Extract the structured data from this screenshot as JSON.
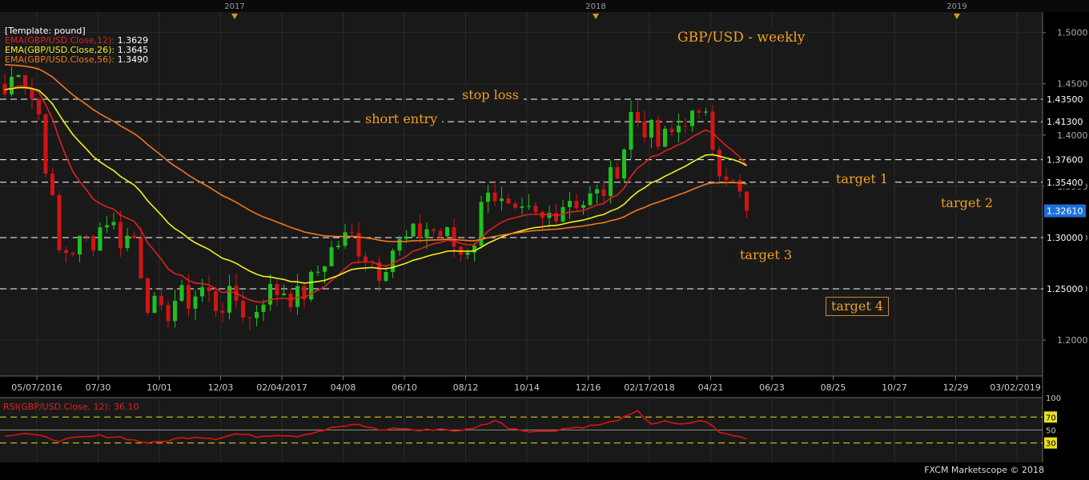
{
  "chart_data": [
    {
      "type": "candlestick",
      "title": "GBP/USD - weekly",
      "template_label": "[Template: pound]",
      "indicators": [
        {
          "label": "EMA(GBP/USD.Close,12):",
          "value": "1.3629",
          "color": "#e02020"
        },
        {
          "label": "EMA(GBP/USD.Close,26):",
          "value": "1.3645",
          "color": "#f0f020"
        },
        {
          "label": "EMA(GBP/USD.Close,56):",
          "value": "1.3490",
          "color": "#f07820"
        }
      ],
      "year_markers": [
        "2017",
        "2018",
        "2019"
      ],
      "x_tick_labels": [
        "05/07/2016",
        "07/30",
        "10/01",
        "12/03",
        "02/04/2017",
        "04/08",
        "06/10",
        "08/12",
        "10/14",
        "12/16",
        "02/17/2018",
        "04/21",
        "06/23",
        "08/25",
        "10/27",
        "12/29",
        "03/02/2019"
      ],
      "y_tick_labels": [
        "1.5000",
        "1.4500",
        "1.4000",
        "1.3500",
        "1.3000",
        "1.2500",
        "1.2000"
      ],
      "ylim": [
        1.165,
        1.52
      ],
      "price_levels": [
        {
          "value": 1.435,
          "label": "1.43500"
        },
        {
          "value": 1.413,
          "label": "1.41300"
        },
        {
          "value": 1.376,
          "label": "1.37600"
        },
        {
          "value": 1.354,
          "label": "1.35400"
        },
        {
          "value": 1.3,
          "label": "1.30000"
        },
        {
          "value": 1.25,
          "label": "1.25000"
        }
      ],
      "current_price": {
        "value": 1.3261,
        "label": "1.32610"
      },
      "annotations": [
        "GBP/USD - weekly",
        "stop loss",
        "short entry",
        "target 1",
        "target 2",
        "target 3",
        "target 4"
      ],
      "anchors": [
        {
          "week": 0,
          "price": 1.44
        },
        {
          "week": 2,
          "price": 1.47
        },
        {
          "week": 5,
          "price": 1.42
        },
        {
          "week": 7,
          "price": 1.33
        },
        {
          "week": 8,
          "price": 1.285
        },
        {
          "week": 10,
          "price": 1.29
        },
        {
          "week": 13,
          "price": 1.3
        },
        {
          "week": 15,
          "price": 1.32
        },
        {
          "week": 17,
          "price": 1.3
        },
        {
          "week": 19,
          "price": 1.3
        },
        {
          "week": 21,
          "price": 1.24
        },
        {
          "week": 23,
          "price": 1.22
        },
        {
          "week": 25,
          "price": 1.24
        },
        {
          "week": 27,
          "price": 1.24
        },
        {
          "week": 29,
          "price": 1.25
        },
        {
          "week": 31,
          "price": 1.235
        },
        {
          "week": 34,
          "price": 1.24
        },
        {
          "week": 36,
          "price": 1.22
        },
        {
          "week": 38,
          "price": 1.245
        },
        {
          "week": 41,
          "price": 1.25
        },
        {
          "week": 43,
          "price": 1.24
        },
        {
          "week": 45,
          "price": 1.255
        },
        {
          "week": 47,
          "price": 1.28
        },
        {
          "week": 49,
          "price": 1.295
        },
        {
          "week": 51,
          "price": 1.3
        },
        {
          "week": 53,
          "price": 1.285
        },
        {
          "week": 55,
          "price": 1.27
        },
        {
          "week": 57,
          "price": 1.29
        },
        {
          "week": 60,
          "price": 1.3
        },
        {
          "week": 62,
          "price": 1.31
        },
        {
          "week": 65,
          "price": 1.3
        },
        {
          "week": 67,
          "price": 1.285
        },
        {
          "week": 69,
          "price": 1.3
        },
        {
          "week": 71,
          "price": 1.355
        },
        {
          "week": 73,
          "price": 1.33
        },
        {
          "week": 75,
          "price": 1.315
        },
        {
          "week": 77,
          "price": 1.32
        },
        {
          "week": 79,
          "price": 1.315
        },
        {
          "week": 81,
          "price": 1.33
        },
        {
          "week": 83,
          "price": 1.34
        },
        {
          "week": 85,
          "price": 1.335
        },
        {
          "week": 87,
          "price": 1.34
        },
        {
          "week": 89,
          "price": 1.355
        },
        {
          "week": 91,
          "price": 1.39
        },
        {
          "week": 92,
          "price": 1.42
        },
        {
          "week": 94,
          "price": 1.41
        },
        {
          "week": 96,
          "price": 1.39
        },
        {
          "week": 98,
          "price": 1.4
        },
        {
          "week": 100,
          "price": 1.42
        },
        {
          "week": 102,
          "price": 1.41
        },
        {
          "week": 103,
          "price": 1.43
        },
        {
          "week": 104,
          "price": 1.4
        },
        {
          "week": 105,
          "price": 1.37
        },
        {
          "week": 106,
          "price": 1.35
        },
        {
          "week": 107,
          "price": 1.35
        },
        {
          "week": 108,
          "price": 1.34
        },
        {
          "week": 109,
          "price": 1.3261
        }
      ],
      "colors": {
        "up": "#1fc01f",
        "down": "#d01414",
        "background": "#191919",
        "grid": "#2a2a2a",
        "level_line": "#ffffff",
        "label_text": "#f0a020",
        "current_price_bg": "#1e6fd9"
      }
    },
    {
      "type": "line",
      "title": "RSI(GBP/USD.Close, 12): 36.10",
      "y_tick_labels": [
        "100",
        "70",
        "50",
        "30"
      ],
      "ylim": [
        0,
        100
      ],
      "reference_levels": [
        30,
        50,
        70
      ],
      "anchors": [
        {
          "week": 0,
          "rsi": 42
        },
        {
          "week": 3,
          "rsi": 45
        },
        {
          "week": 6,
          "rsi": 38
        },
        {
          "week": 8,
          "rsi": 34
        },
        {
          "week": 11,
          "rsi": 38
        },
        {
          "week": 14,
          "rsi": 41
        },
        {
          "week": 17,
          "rsi": 39
        },
        {
          "week": 20,
          "rsi": 32
        },
        {
          "week": 22,
          "rsi": 30
        },
        {
          "week": 25,
          "rsi": 36
        },
        {
          "week": 28,
          "rsi": 40
        },
        {
          "week": 31,
          "rsi": 37
        },
        {
          "week": 34,
          "rsi": 44
        },
        {
          "week": 37,
          "rsi": 40
        },
        {
          "week": 40,
          "rsi": 43
        },
        {
          "week": 43,
          "rsi": 41
        },
        {
          "week": 46,
          "rsi": 48
        },
        {
          "week": 49,
          "rsi": 55
        },
        {
          "week": 52,
          "rsi": 58
        },
        {
          "week": 55,
          "rsi": 50
        },
        {
          "week": 58,
          "rsi": 53
        },
        {
          "week": 61,
          "rsi": 49
        },
        {
          "week": 64,
          "rsi": 52
        },
        {
          "week": 67,
          "rsi": 48
        },
        {
          "week": 70,
          "rsi": 57
        },
        {
          "week": 72,
          "rsi": 65
        },
        {
          "week": 74,
          "rsi": 54
        },
        {
          "week": 76,
          "rsi": 50
        },
        {
          "week": 79,
          "rsi": 47
        },
        {
          "week": 82,
          "rsi": 52
        },
        {
          "week": 85,
          "rsi": 55
        },
        {
          "week": 88,
          "rsi": 59
        },
        {
          "week": 91,
          "rsi": 69
        },
        {
          "week": 93,
          "rsi": 78
        },
        {
          "week": 95,
          "rsi": 60
        },
        {
          "week": 97,
          "rsi": 63
        },
        {
          "week": 99,
          "rsi": 58
        },
        {
          "week": 101,
          "rsi": 62
        },
        {
          "week": 103,
          "rsi": 64
        },
        {
          "week": 105,
          "rsi": 46
        },
        {
          "week": 107,
          "rsi": 42
        },
        {
          "week": 109,
          "rsi": 36.1
        }
      ],
      "line_color": "#e01010",
      "level_color": "#e8e020",
      "tick_highlight_color": "#e8e020"
    }
  ],
  "footer": "FXCM Marketscope © 2018"
}
